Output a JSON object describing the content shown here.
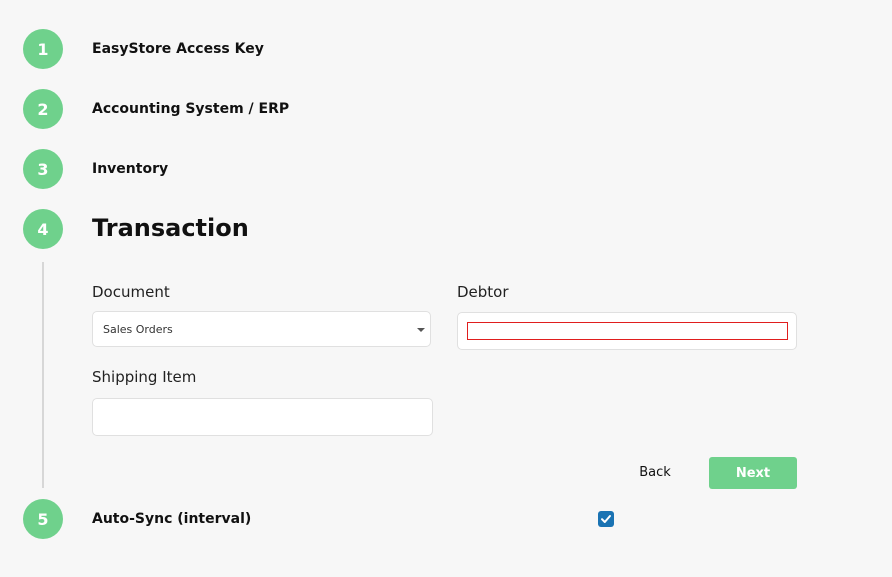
{
  "steps": [
    {
      "number": "1",
      "title": "EasyStore Access Key"
    },
    {
      "number": "2",
      "title": "Accounting System / ERP"
    },
    {
      "number": "3",
      "title": "Inventory"
    },
    {
      "number": "4",
      "title": "Transaction"
    },
    {
      "number": "5",
      "title": "Auto-Sync (interval)"
    }
  ],
  "transaction": {
    "document_label": "Document",
    "document_selected": "Sales Orders",
    "debtor_label": "Debtor",
    "debtor_value": "",
    "shipping_label": "Shipping Item",
    "shipping_value": "",
    "back_label": "Back",
    "next_label": "Next"
  },
  "auto_sync": {
    "checked": true
  },
  "colors": {
    "accent": "#6fd18c",
    "checkbox": "#1a73b3",
    "error_border": "#e01e1e"
  }
}
